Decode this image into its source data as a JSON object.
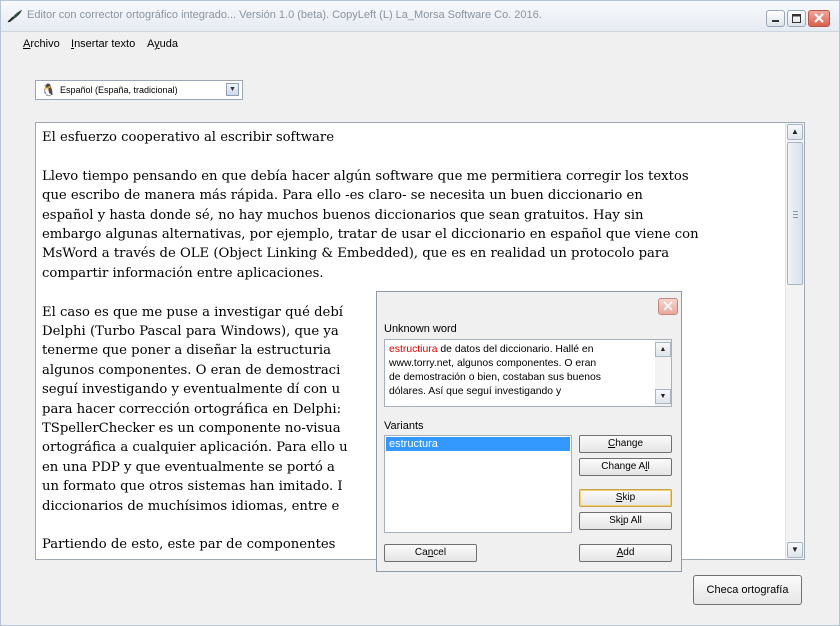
{
  "window": {
    "title": "Editor con corrector ortográfico integrado... Versión 1.0 (beta). CopyLeft (L) La_Morsa Software Co. 2016."
  },
  "menu": [
    {
      "accel": "A",
      "rest": "rchivo"
    },
    {
      "accel": "I",
      "rest": "nsertar texto"
    },
    {
      "accel": "",
      "pre": "A",
      "accelmid": "y",
      "rest": "uda"
    }
  ],
  "language": {
    "selected": "Español (España, tradicional)"
  },
  "editor": {
    "lines": [
      [
        "El esfuerzo cooperativo al escribir software"
      ],
      [
        "Llevo tiempo pensando en que debía hacer algún software que me permitiera corregir los textos",
        "que escribo de manera más rápida. Para ello -es claro- se necesita un buen diccionario en",
        "español y hasta donde sé, no hay muchos buenos diccionarios que sean gratuitos. Hay sin",
        "embargo algunas alternativas, por ejemplo, tratar de usar el diccionario en español que viene con",
        "MsWord a través de OLE (Object Linking & Embedded), que es en realidad un protocolo para",
        "compartir información entre aplicaciones."
      ],
      [
        "El caso es que me puse a investigar qué debí                                                    es para",
        "Delphi (Turbo Pascal para Windows), que ya                                                      sencilla, sin",
        "tenerme que poner a diseñar la estructuria                                                      rry.net,",
        "algunos componentes. O eran de demostraci                                                       Así que",
        "seguí investigando y eventualmente dí con u                                                     omponentes",
        "para hacer corrección ortográfica en Delphi:                                                    Box.",
        "TSpellerChecker es un componente no-visua                                                       ón",
        "ortográfica a cualquier aplicación. Para ello u                                                 r que nació",
        "en una PDP y que eventualmente se portó a                                                        es que usa",
        "un formato que otros sistemas han imitado. I                                                     hos",
        "diccionarios de muchísimos idiomas, entre e"
      ],
      [
        "Partiendo de esto, este par de componentes                                                       ue quiero"
      ]
    ]
  },
  "check_button": {
    "label": "Checa ortografía"
  },
  "dialog": {
    "unknown_label": "Unknown word",
    "bad_word": "estructiura",
    "context_lines": [
      " de datos del diccionario. Hallé en",
      "www.torry.net, algunos componentes. O eran",
      "de demostración o bien, costaban sus buenos",
      "dólares. Así que seguí investigando y"
    ],
    "variants_label": "Variants",
    "variants": [
      "estructura"
    ],
    "buttons": {
      "change": {
        "accel": "C",
        "rest": "hange"
      },
      "change_all": {
        "pre": "Change A",
        "accel": "l",
        "rest": "l"
      },
      "skip": {
        "accel": "S",
        "rest": "kip"
      },
      "skip_all": {
        "pre": "Sk",
        "accel": "i",
        "rest": "p All"
      },
      "cancel": {
        "pre": "Ca",
        "accel": "n",
        "rest": "cel"
      },
      "add": {
        "accel": "A",
        "rest": "dd"
      }
    }
  }
}
